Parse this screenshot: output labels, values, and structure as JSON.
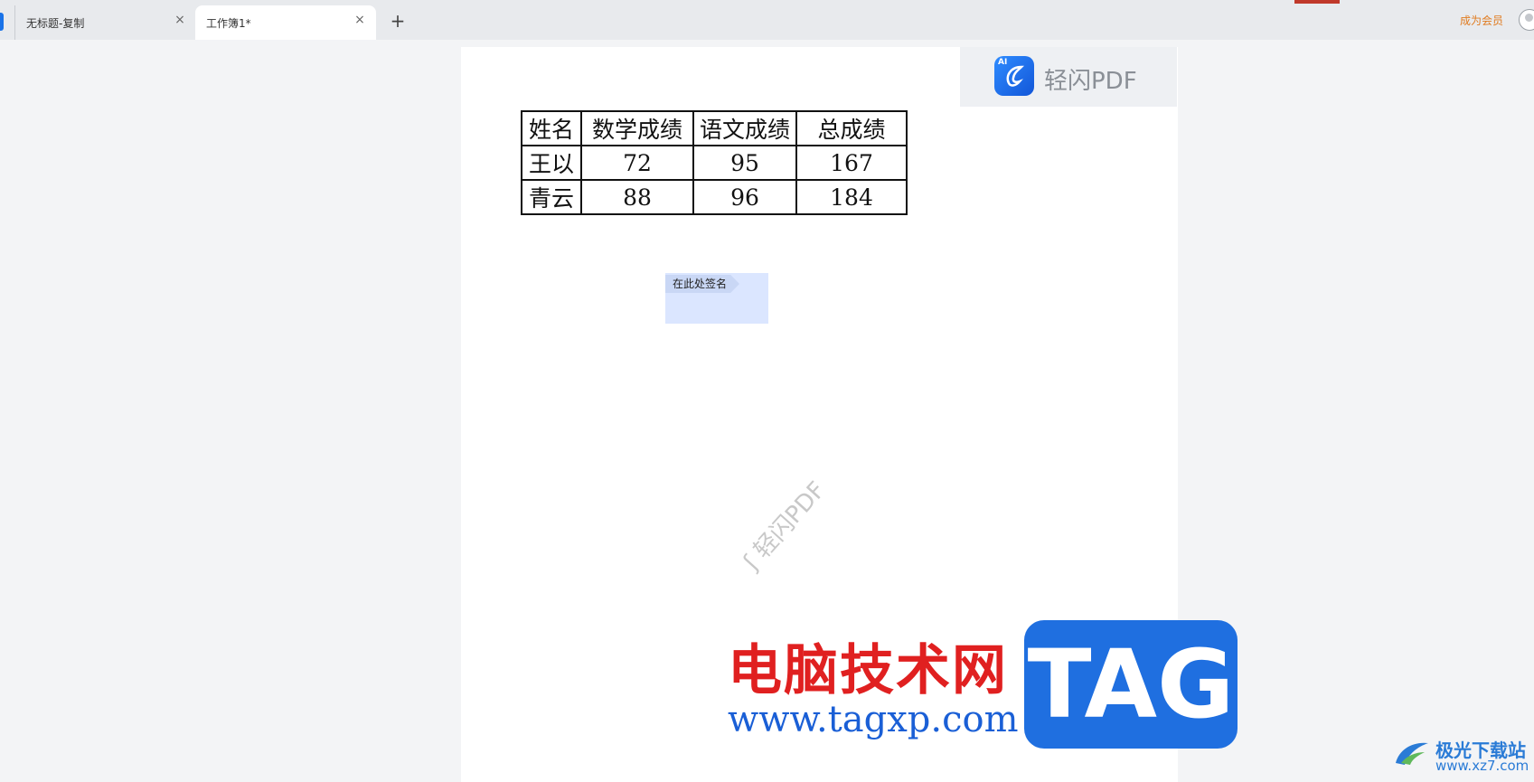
{
  "tabs": [
    {
      "label": "无标题-复制",
      "close": "×"
    },
    {
      "label": "工作簿1*",
      "close": "×"
    }
  ],
  "newtab": "+",
  "header": {
    "member_label": "成为会员"
  },
  "logo": {
    "ai": "AI",
    "text": "轻闪PDF"
  },
  "table": {
    "headers": [
      "姓名",
      "数学成绩",
      "语文成绩",
      "总成绩"
    ],
    "rows": [
      [
        "王以",
        "72",
        "95",
        "167"
      ],
      [
        "青云",
        "88",
        "96",
        "184"
      ]
    ]
  },
  "signature": {
    "label": "在此处签名"
  },
  "watermark": {
    "text": "轻闪PDF"
  },
  "site": {
    "title": "电脑技术网",
    "url": "www.tagxp.com",
    "tag": "TAG"
  },
  "corner": {
    "title": "极光下载站",
    "url": "www.xz7.com"
  },
  "colors": {
    "accent": "#1a73e8",
    "member": "#e07b1f",
    "site_red": "#e02020",
    "tag_blue": "#1f6fe0"
  }
}
